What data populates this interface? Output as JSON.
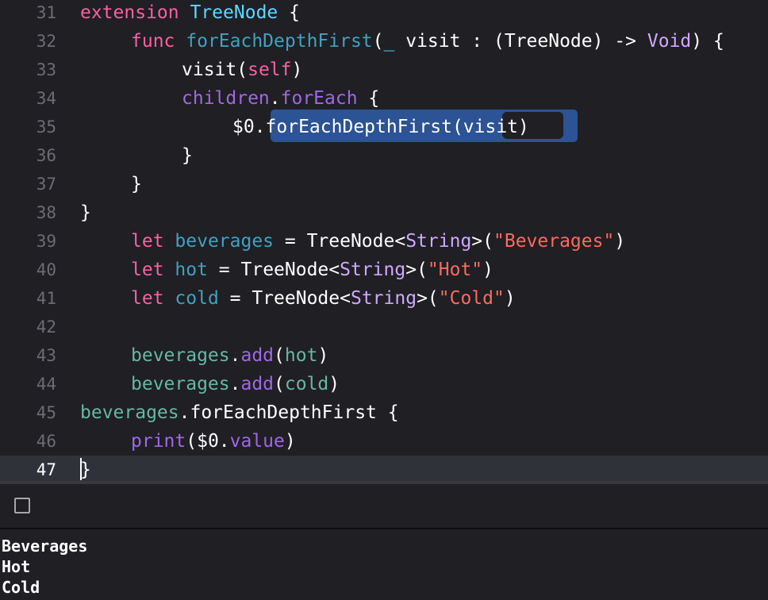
{
  "colors": {
    "background": "#1f1f24",
    "current_line": "#2f3239",
    "keyword": "#fc5fa3",
    "type_decl": "#5dd8ff",
    "project_name": "#67b7a4",
    "project_func": "#41a1c0",
    "other_type": "#d0a8ff",
    "other_func": "#a167e6",
    "string": "#fc6a5d",
    "plain": "#ffffff",
    "line_number": "#6c6c73",
    "selection": "#2c5393"
  },
  "editor": {
    "lines": [
      {
        "number": "31",
        "indent": 0,
        "tokens": [
          {
            "t": "extension",
            "k": "keyword"
          },
          {
            "t": " ",
            "k": "plain"
          },
          {
            "t": "TreeNode",
            "k": "type_decl"
          },
          {
            "t": " {",
            "k": "plain"
          }
        ]
      },
      {
        "number": "32",
        "indent": 1,
        "tokens": [
          {
            "t": "func",
            "k": "keyword"
          },
          {
            "t": " ",
            "k": "plain"
          },
          {
            "t": "forEachDepthFirst",
            "k": "project_func"
          },
          {
            "t": "(",
            "k": "plain"
          },
          {
            "t": "_",
            "k": "type_decl"
          },
          {
            "t": " visit : (TreeNode) -> ",
            "k": "plain"
          },
          {
            "t": "Void",
            "k": "other_type"
          },
          {
            "t": ") {",
            "k": "plain"
          }
        ]
      },
      {
        "number": "33",
        "indent": 2,
        "tokens": [
          {
            "t": "visit(",
            "k": "plain"
          },
          {
            "t": "self",
            "k": "keyword"
          },
          {
            "t": ")",
            "k": "plain"
          }
        ]
      },
      {
        "number": "34",
        "indent": 2,
        "tokens": [
          {
            "t": "children",
            "k": "other_func"
          },
          {
            "t": ".",
            "k": "plain"
          },
          {
            "t": "forEach",
            "k": "other_func"
          },
          {
            "t": " {",
            "k": "plain"
          }
        ]
      },
      {
        "number": "35",
        "indent": 3,
        "tokens": [
          {
            "t": "$0.",
            "k": "plain"
          },
          {
            "t": "forEachDepthFirst(visit)",
            "k": "plain"
          }
        ]
      },
      {
        "number": "36",
        "indent": 2,
        "tokens": [
          {
            "t": "}",
            "k": "plain"
          }
        ]
      },
      {
        "number": "37",
        "indent": 1,
        "tokens": [
          {
            "t": "}",
            "k": "plain"
          }
        ]
      },
      {
        "number": "38",
        "indent": 0,
        "tokens": [
          {
            "t": "}",
            "k": "plain"
          }
        ]
      },
      {
        "number": "39",
        "indent": 1,
        "tokens": [
          {
            "t": "let",
            "k": "keyword"
          },
          {
            "t": " ",
            "k": "plain"
          },
          {
            "t": "beverages",
            "k": "project_func"
          },
          {
            "t": " = TreeNode<",
            "k": "plain"
          },
          {
            "t": "String",
            "k": "other_type"
          },
          {
            "t": ">(",
            "k": "plain"
          },
          {
            "t": "\"Beverages\"",
            "k": "string"
          },
          {
            "t": ")",
            "k": "plain"
          }
        ]
      },
      {
        "number": "40",
        "indent": 1,
        "tokens": [
          {
            "t": "let",
            "k": "keyword"
          },
          {
            "t": " ",
            "k": "plain"
          },
          {
            "t": "hot",
            "k": "project_func"
          },
          {
            "t": " = TreeNode<",
            "k": "plain"
          },
          {
            "t": "String",
            "k": "other_type"
          },
          {
            "t": ">(",
            "k": "plain"
          },
          {
            "t": "\"Hot\"",
            "k": "string"
          },
          {
            "t": ")",
            "k": "plain"
          }
        ]
      },
      {
        "number": "41",
        "indent": 1,
        "tokens": [
          {
            "t": "let",
            "k": "keyword"
          },
          {
            "t": " ",
            "k": "plain"
          },
          {
            "t": "cold",
            "k": "project_func"
          },
          {
            "t": " = TreeNode<",
            "k": "plain"
          },
          {
            "t": "String",
            "k": "other_type"
          },
          {
            "t": ">(",
            "k": "plain"
          },
          {
            "t": "\"Cold\"",
            "k": "string"
          },
          {
            "t": ")",
            "k": "plain"
          }
        ]
      },
      {
        "number": "42",
        "indent": 0,
        "tokens": []
      },
      {
        "number": "43",
        "indent": 1,
        "tokens": [
          {
            "t": "beverages",
            "k": "project_name"
          },
          {
            "t": ".",
            "k": "plain"
          },
          {
            "t": "add",
            "k": "other_func"
          },
          {
            "t": "(",
            "k": "plain"
          },
          {
            "t": "hot",
            "k": "project_name"
          },
          {
            "t": ")",
            "k": "plain"
          }
        ]
      },
      {
        "number": "44",
        "indent": 1,
        "tokens": [
          {
            "t": "beverages",
            "k": "project_name"
          },
          {
            "t": ".",
            "k": "plain"
          },
          {
            "t": "add",
            "k": "other_func"
          },
          {
            "t": "(",
            "k": "plain"
          },
          {
            "t": "cold",
            "k": "project_name"
          },
          {
            "t": ")",
            "k": "plain"
          }
        ]
      },
      {
        "number": "45",
        "indent": 0,
        "tokens": [
          {
            "t": "beverages",
            "k": "project_name"
          },
          {
            "t": ".",
            "k": "plain"
          },
          {
            "t": "forEachDepthFirst",
            "k": "plain"
          },
          {
            "t": " {",
            "k": "plain"
          }
        ]
      },
      {
        "number": "46",
        "indent": 1,
        "tokens": [
          {
            "t": "print",
            "k": "other_func"
          },
          {
            "t": "($0.",
            "k": "plain"
          },
          {
            "t": "value",
            "k": "other_func"
          },
          {
            "t": ")",
            "k": "plain"
          }
        ]
      },
      {
        "number": "47",
        "indent": 0,
        "current": true,
        "tokens": [
          {
            "t": "}",
            "k": "plain"
          }
        ]
      }
    ]
  },
  "debug_bar": {
    "toggle_icon": "square-console-toggle-icon"
  },
  "console": {
    "output_lines": [
      "Beverages",
      "Hot",
      "Cold"
    ]
  }
}
